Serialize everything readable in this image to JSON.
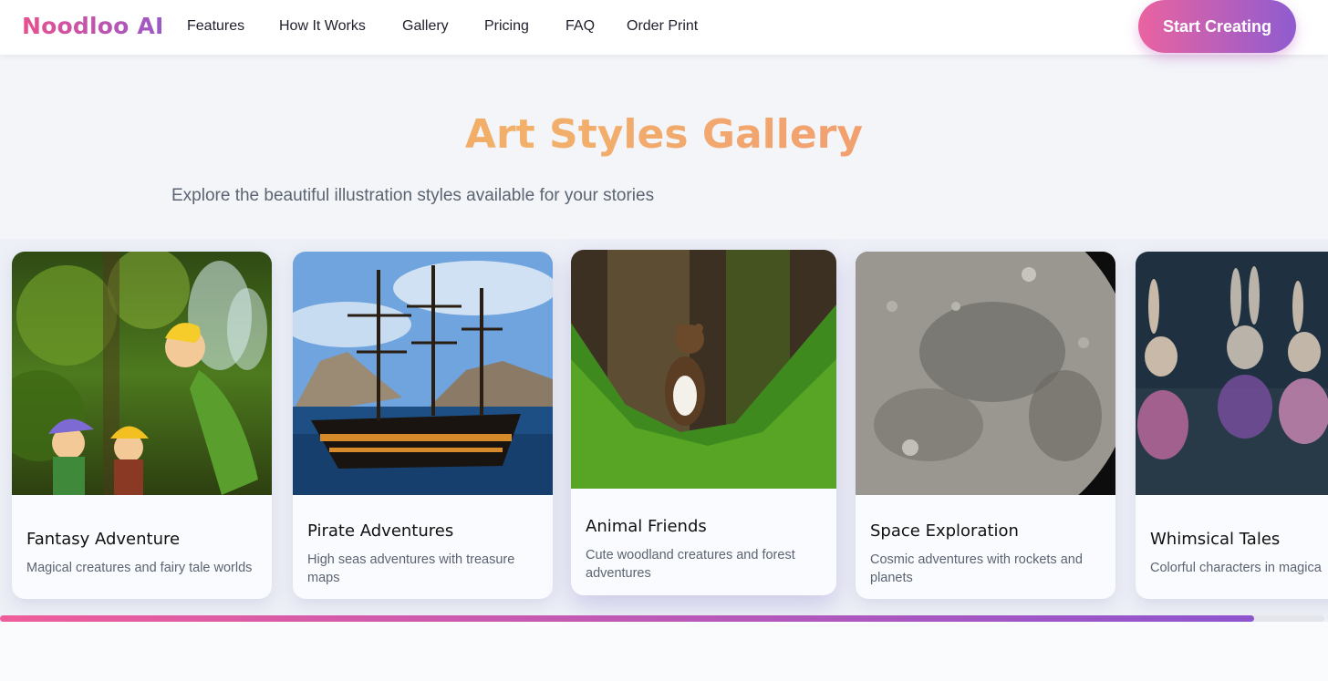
{
  "brand": {
    "logo": "Noodloo AI",
    "accent_pink": "#e8508f",
    "accent_purple": "#8e5cd0"
  },
  "nav": {
    "items": [
      {
        "label": "Features"
      },
      {
        "label": "How It Works"
      },
      {
        "label": "Gallery"
      },
      {
        "label": "Pricing"
      },
      {
        "label": "FAQ"
      },
      {
        "label": "Order Print"
      }
    ],
    "cta_label": "Start Creating"
  },
  "gallery": {
    "title": "Art Styles Gallery",
    "subtitle": "Explore the beautiful illustration styles available for your stories",
    "cards": [
      {
        "title": "Fantasy Adventure",
        "description": "Magical creatures and fairy tale worlds",
        "image": "fairy-figurines-image"
      },
      {
        "title": "Pirate Adventures",
        "description": "High seas adventures with treasure maps",
        "image": "pirate-ship-image"
      },
      {
        "title": "Animal Friends",
        "description": "Cute woodland creatures and forest adventures",
        "image": "marten-forest-image"
      },
      {
        "title": "Space Exploration",
        "description": "Cosmic adventures with rockets and planets",
        "image": "moon-surface-image"
      },
      {
        "title": "Whimsical Tales",
        "description": "Colorful characters in magica",
        "image": "crochet-bunnies-image"
      }
    ],
    "scroll_progress": 0.947
  }
}
